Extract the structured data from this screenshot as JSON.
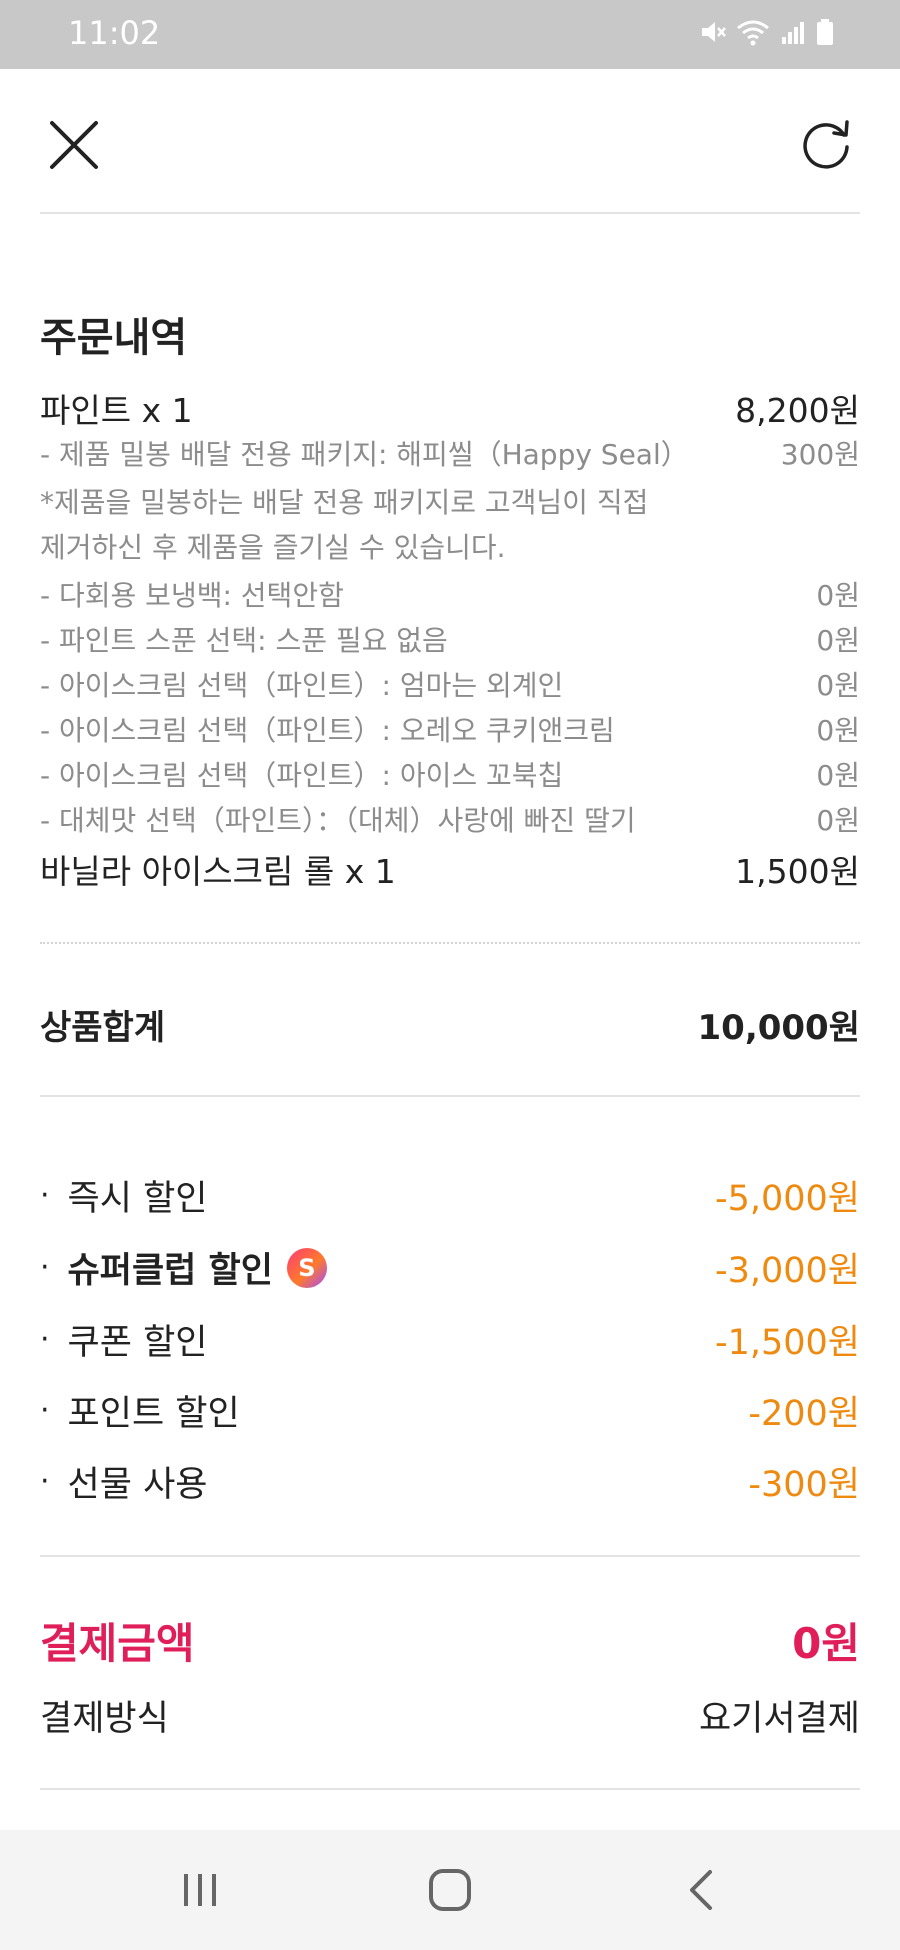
{
  "status_bar": {
    "time": "11:02"
  },
  "order": {
    "section_title": "주문내역",
    "items": [
      {
        "name": "파인트 x 1",
        "price": "8,200원"
      },
      {
        "name": "바닐라 아이스크림 롤 x 1",
        "price": "1,500원"
      }
    ],
    "options": [
      {
        "label": "- 제품 밀봉 배달 전용 패키지: 해피씰（Happy Seal）",
        "price": "300원"
      },
      {
        "label": "- 다회용 보냉백: 선택안함",
        "price": "0원"
      },
      {
        "label": "- 파인트 스푼 선택: 스푼 필요 없음",
        "price": "0원"
      },
      {
        "label": "- 아이스크림 선택（파인트）: 엄마는 외계인",
        "price": "0원"
      },
      {
        "label": "- 아이스크림 선택（파인트）: 오레오 쿠키앤크림",
        "price": "0원"
      },
      {
        "label": "- 아이스크림 선택（파인트）: 아이스 꼬북칩",
        "price": "0원"
      },
      {
        "label": "- 대체맛 선택（파인트）：（대체）사랑에 빠진 딸기",
        "price": "0원"
      }
    ],
    "note_line1": "*제품을 밀봉하는 배달 전용 패키지로 고객님이 직접",
    "note_line2": "제거하신 후 제품을 즐기실 수 있습니다."
  },
  "subtotal": {
    "label": "상품합계",
    "value": "10,000원"
  },
  "discounts": [
    {
      "bullet": "·",
      "label": "즉시 할인",
      "value": "-5,000원"
    },
    {
      "bullet": "·",
      "label": "슈퍼클럽 할인",
      "value": "-3,000원",
      "badge": "S"
    },
    {
      "bullet": "·",
      "label": "쿠폰 할인",
      "value": "-1,500원"
    },
    {
      "bullet": "·",
      "label": "포인트 할인",
      "value": "-200원"
    },
    {
      "bullet": "·",
      "label": "선물 사용",
      "value": "-300원"
    }
  ],
  "payment": {
    "total_label": "결제금액",
    "total_value": "0원",
    "method_label": "결제방식",
    "method_value": "요기서결제"
  },
  "colors": {
    "discount": "#ef8a10",
    "total": "#e01e5a",
    "status_bar": "#c8c8c8"
  },
  "icons": {
    "close": "close-icon",
    "refresh": "refresh-icon",
    "nav_recent": "recent-apps-icon",
    "nav_home": "home-icon",
    "nav_back": "back-icon"
  }
}
